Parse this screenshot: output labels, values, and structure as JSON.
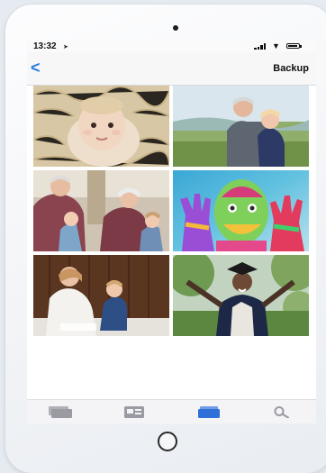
{
  "status_bar": {
    "time": "13:32",
    "location_icon": "location-arrow-icon",
    "signal_icon": "cellular-signal-icon",
    "wifi_icon": "wifi-icon",
    "battery_icon": "battery-icon"
  },
  "nav_bar": {
    "back_icon": "chevron-left-icon",
    "back_glyph": "<",
    "action_label": "Backup"
  },
  "photos": [
    {
      "subject": "baby-on-fur-blanket"
    },
    {
      "subject": "grandfather-with-child-outdoors"
    },
    {
      "subject": "grandparents-with-grandchildren"
    },
    {
      "subject": "woman-with-painted-hands"
    },
    {
      "subject": "mother-and-son-on-floor"
    },
    {
      "subject": "graduate-celebrating"
    }
  ],
  "tab_bar": {
    "tabs": [
      {
        "icon": "photos-stack-icon",
        "selected": false
      },
      {
        "icon": "albums-icon",
        "selected": false
      },
      {
        "icon": "shared-icon",
        "selected": true
      },
      {
        "icon": "search-icon",
        "selected": false
      }
    ],
    "accent_color": "#2f6fd8",
    "inactive_color": "#9a9aa3"
  },
  "device": {
    "camera_icon": "front-camera-icon",
    "home_button_icon": "home-button-icon"
  }
}
